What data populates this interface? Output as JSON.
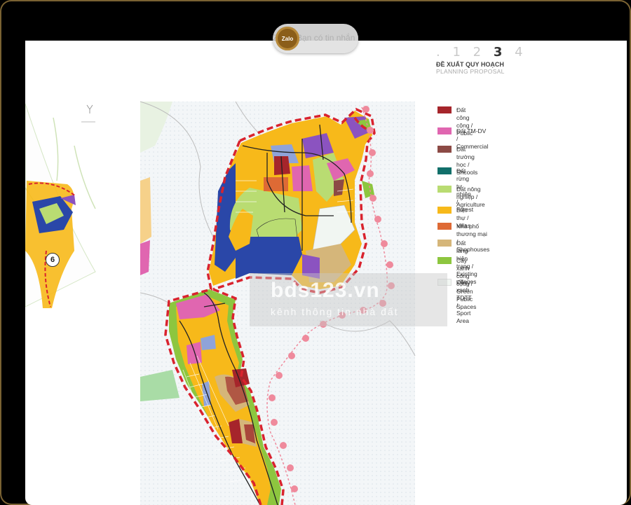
{
  "header": {
    "steps": [
      ".",
      "1",
      "2",
      "3",
      "4"
    ],
    "current_step": "3",
    "title": "ĐỀ XUẤT QUY HOẠCH",
    "subtitle": "PLANNING PROPOSAL"
  },
  "legend": {
    "items": [
      {
        "label": "Đất công cộng / Public",
        "color": "#a6252b"
      },
      {
        "label": "Đất TM-DV / Commercial",
        "color": "#e066b0"
      },
      {
        "label": "Đất trường học /\nShcools",
        "color": "#8c4a45"
      },
      {
        "label": "Đất rừng tự nhiên / Forest",
        "color": "#116f6a"
      },
      {
        "label": "Đất nông nghiệp / Agriculture",
        "color": "#b9dc72"
      },
      {
        "label": "Biệt thự / Villas",
        "color": "#f7b91a"
      },
      {
        "label": "Nhà phố thương mại / Shophouses",
        "color": "#de6a35"
      },
      {
        "label": "Đất làng hiện trạng / Existing villages",
        "color": "#d5b67a"
      },
      {
        "label": "Cây xanh công cộng /\nGreen Public Spaces",
        "color": "#8dc63f"
      },
      {
        "label": "Cây xanh TDTT / Sport Area",
        "color": "#f1f6f2"
      }
    ]
  },
  "zalo_notification": {
    "logo_text": "Zalo",
    "text": "Zalo - Bạn có tin nhắn mới"
  },
  "watermark": {
    "main": "bds123.vn",
    "sub": "kênh thông tin nhà đất"
  },
  "inset_badge": "6",
  "colors": {
    "frame_border": "#7a6232",
    "boundary": "#d9232e",
    "route": "#ef8a9c",
    "water": "#2a47a8"
  }
}
